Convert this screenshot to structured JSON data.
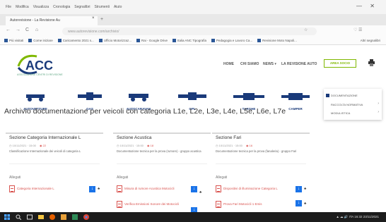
{
  "menubar": {
    "items": [
      "File",
      "Modifica",
      "Visualizza",
      "Cronologia",
      "Segnalibri",
      "Strumenti",
      "Aiuto"
    ],
    "minimize": "—",
    "close": "✕"
  },
  "tab": {
    "title": "Autorevisione - La Revisione Au",
    "close": "×",
    "new": "+"
  },
  "nav": {
    "back": "←",
    "forward": "→",
    "reload": "C",
    "home": "⌂",
    "url": "www.autorevisione.com/archivio/",
    "url_icons": "☆",
    "right_icons": "♡ ☰"
  },
  "bookmarks": [
    "Più visitati",
    "Come iniziare",
    "Caricamento 2021 s...",
    "Ufficio Motorizzaz...",
    "Rai - Google Drive",
    "Italia ANC Tipografia",
    "Pedagogia e Lavoro Ca...",
    "Revisione Moto Napoli..."
  ],
  "bookmarks_right": "Altri segnalibri",
  "site": {
    "logo_text": "ACC",
    "logo_tag": "ASSOCIAZIONE CENTRI DI REVISIONE",
    "nav": [
      "HOME",
      "CHI SIAMO",
      "NEWS",
      "LA REVISIONE AUTO"
    ],
    "nav_arrow": "▾",
    "area_button": "AREA SOCIO"
  },
  "vehicles": [
    "AUTOVETTURE",
    "GAS",
    "AUTOCARAVAN",
    "GPL",
    "TARGHE",
    "CAMPER"
  ],
  "dropdown": {
    "items": [
      "DOCUMENTAZIONE",
      "RACCOLTA NORMATIVA",
      "MODULISTICA"
    ],
    "arrow": "›"
  },
  "page_title": "Archivio documentazione per veicoli con categoria L1e, L2e, L3e, L4e, L5e, L6e, L7e",
  "attachments_label": "Allegati",
  "cards": [
    {
      "title": "Sezione Categoria Internazionale L",
      "date": "10/11/2021 · 15:00",
      "hits": "22",
      "desc": "Classificazione Internazionale dei veicoli di categoria L",
      "files": [
        "Categoria Internazionale L"
      ]
    },
    {
      "title": "Sezione Acustica",
      "date": "10/11/2021 · 15:00",
      "hits": "18",
      "desc": "Documentazione tecnica per la prova (rumore) - gruppo acustica",
      "files": [
        "Misura di rumore Acustica Motocicli",
        "Verifica Emissioni Sonore dei Motocicli"
      ]
    },
    {
      "title": "Sezione Fari",
      "date": "10/11/2021 · 15:00",
      "hits": "16",
      "desc": "Documentazione tecnica per la prova (fanaleria) - gruppo Fari",
      "files": [
        "Dispositivi di illuminazione Categoria L",
        "Prova Fari Motocicli 1 Emis"
      ]
    }
  ],
  "download_icon": "↓",
  "share_icon": "♣",
  "taskbar": {
    "status": "▲  ☁  🔊  ITA  16:32  23/11/2021"
  },
  "colors": {
    "accent_green": "#7fb800",
    "brand_blue": "#1a3a7a",
    "pdf_red": "#d9534f",
    "button_blue": "#1a73e8"
  }
}
